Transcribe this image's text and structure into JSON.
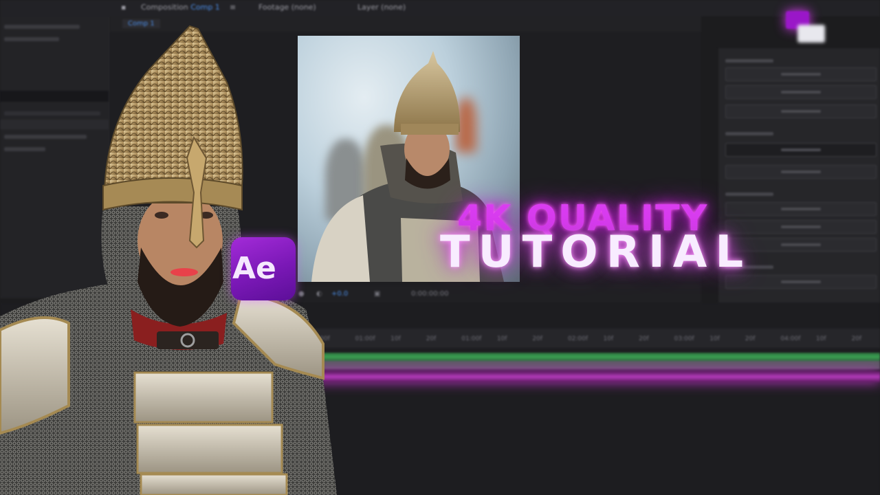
{
  "window": {
    "tabs": {
      "composition_prefix": "Composition",
      "composition_name": "Comp 1",
      "footage": "Footage (none)",
      "layer": "Layer (none)"
    },
    "comp_tab_label": "Comp 1"
  },
  "viewer_toolbar": {
    "zoom": "+0.0",
    "timecode": "0:00:00:00"
  },
  "timeline": {
    "ruler_ticks": [
      "00f",
      "01:00f",
      "10f",
      "20f",
      "01:00f",
      "10f",
      "20f",
      "02:00f",
      "10f",
      "20f",
      "03:00f",
      "10f",
      "20f",
      "04:00f",
      "10f",
      "20f"
    ]
  },
  "overlay": {
    "line1": "4K QUALITY",
    "line2": "TUTORIAL"
  },
  "logo": {
    "text": "Ae"
  },
  "colors": {
    "accent_purple": "#d93df0",
    "timeline_green": "#3ba152",
    "timeline_pink": "#b23ab8",
    "tab_blue": "#4b8ee8"
  },
  "icons": [
    "folder-icon",
    "lock-icon",
    "camera-icon",
    "color-icon"
  ]
}
